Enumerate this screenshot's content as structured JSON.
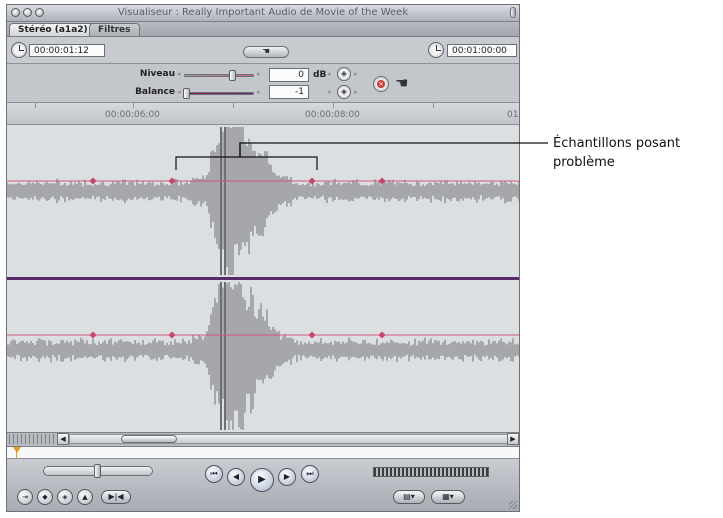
{
  "window": {
    "title": "Visualiseur : Really Important Audio de Movie of the Week"
  },
  "tabs": [
    {
      "label": "Stéréo (a1a2)",
      "active": true
    },
    {
      "label": "Filtres",
      "active": false
    }
  ],
  "timecodes": {
    "duration": "00:00:01:12",
    "current": "00:01:00:00"
  },
  "hand_button": {
    "glyph": "☚"
  },
  "levels": {
    "niveau_label": "Niveau",
    "niveau_value": "0",
    "niveau_unit": "dB",
    "balance_label": "Balance",
    "balance_value": "-1"
  },
  "ruler": {
    "labels": [
      "00:00:06:00",
      "00:00:08:00",
      "01"
    ]
  },
  "callout": {
    "text": "Échantillons posant problème"
  },
  "colors": {
    "level_line": "#d2557a",
    "keyframe": "#c8456b",
    "waveform": "#6e6f73",
    "divider": "#5a2a6a",
    "reset_button": "#c93a3a",
    "playhead": "#d9a018"
  },
  "icons": [
    "clock-icon",
    "hand-drag-icon",
    "keyframe-icon",
    "reset-icon",
    "play-icon",
    "prev-edit-icon",
    "next-edit-icon",
    "step-back-icon",
    "step-forward-icon",
    "mark-in-icon",
    "mark-out-icon"
  ]
}
